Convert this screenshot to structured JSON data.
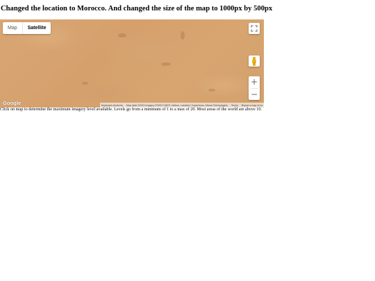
{
  "heading": "Changed the location to Morocco. And changed the size of the map to 1000px by 500px",
  "map": {
    "map_type": {
      "map_label": "Map",
      "satellite_label": "Satellite",
      "selected": "Satellite"
    },
    "zoom": {
      "in_label": "+",
      "out_label": "−"
    },
    "icons": [
      "fullscreen-icon",
      "pegman-icon"
    ],
    "logo_text": "Google",
    "attribution": {
      "shortcuts": "Keyboard shortcuts",
      "data": "Map data ©2023 Imagery ©2023 CNES / Airbus, Landsat / Copernicus, Maxar Technologies",
      "terms": "Terms",
      "report": "Report a map error"
    }
  },
  "caption": "Click on map to determine the maximum imagery level available. Levels go from a minimum of 1 to a max of 20. Most areas of the world are above 10."
}
